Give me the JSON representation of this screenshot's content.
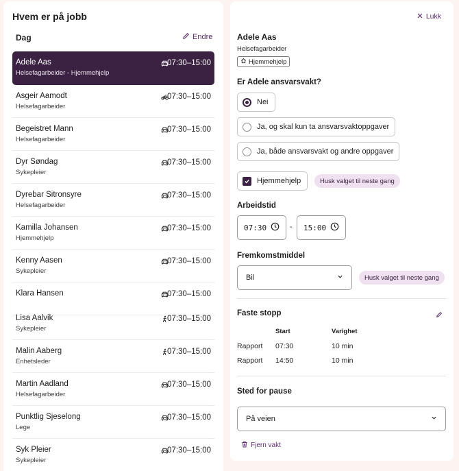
{
  "left": {
    "title": "Hvem er på jobb",
    "section": "Dag",
    "edit_label": "Endre",
    "employees": [
      {
        "name": "Adele Aas",
        "role": "Helsefagarbeider - Hjemmehjelp",
        "time": "07:30–15:00",
        "transport": "car-icon",
        "selected": true
      },
      {
        "name": "Asgeir Aamodt",
        "role": "Helsefagarbeider",
        "time": "07:30–15:00",
        "transport": "bicycle-icon"
      },
      {
        "name": "Begeistret Mann",
        "role": "Helsefagarbeider",
        "time": "07:30–15:00",
        "transport": "car-icon"
      },
      {
        "name": "Dyr Søndag",
        "role": "Sykepleier",
        "time": "07:30–15:00",
        "transport": "car-icon"
      },
      {
        "name": "Dyrebar Sitronsyre",
        "role": "Helsefagarbeider",
        "time": "07:30–15:00",
        "transport": "car-icon"
      },
      {
        "name": "Kamilla Johansen",
        "role": "Hjemmehjelp",
        "time": "07:30–15:00",
        "transport": "car-icon"
      },
      {
        "name": "Kenny Aasen",
        "role": "Sykepleier",
        "time": "07:30–15:00",
        "transport": "car-icon"
      },
      {
        "name": "Klara Hansen",
        "role": "",
        "time": "07:30–15:00",
        "transport": "car-icon"
      },
      {
        "name": "Lisa Aalvik",
        "role": "Sykepleier",
        "time": "07:30–15:00",
        "transport": "walking-icon"
      },
      {
        "name": "Malin Aaberg",
        "role": "Enhetsleder",
        "time": "07:30–15:00",
        "transport": "walking-icon"
      },
      {
        "name": "Martin Aadland",
        "role": "Helsefagarbeider",
        "time": "07:30–15:00",
        "transport": "car-icon"
      },
      {
        "name": "Punktlig Sjeselong",
        "role": "Lege",
        "time": "07:30–15:00",
        "transport": "car-icon"
      },
      {
        "name": "Syk Pleier",
        "role": "Sykepleier",
        "time": "07:30–15:00",
        "transport": "car-icon"
      }
    ]
  },
  "right": {
    "close_label": "Lukk",
    "name": "Adele Aas",
    "role": "Helsefagarbeider",
    "tag": "Hjemmehjelp",
    "on_call_question": "Er Adele ansvarsvakt?",
    "on_call_options": [
      {
        "label": "Nei",
        "selected": true
      },
      {
        "label": "Ja, og skal kun ta ansvarsvaktoppgaver",
        "selected": false
      },
      {
        "label": "Ja, både ansvarsvakt og andre oppgaver",
        "selected": false
      }
    ],
    "home_help": {
      "label": "Hjemmehjelp",
      "checked": true
    },
    "remember_label": "Husk valget til neste gang",
    "work_time": {
      "heading": "Arbeidstid",
      "start": "07:30",
      "separator": "-",
      "end": "15:00"
    },
    "transport": {
      "heading": "Fremkomstmiddel",
      "value": "Bil",
      "remember_label": "Husk valget til neste gang"
    },
    "fixed_stops": {
      "heading": "Faste stopp",
      "columns": [
        "",
        "Start",
        "Varighet"
      ],
      "rows": [
        {
          "name": "Rapport",
          "start": "07:30",
          "duration": "10 min"
        },
        {
          "name": "Rapport",
          "start": "14:50",
          "duration": "10 min"
        }
      ]
    },
    "break_place": {
      "heading": "Sted for pause",
      "value": "På veien"
    },
    "remove_label": "Fjern vakt"
  },
  "colors": {
    "accent": "#3b2142",
    "link": "#5b2b6e",
    "chip": "#efe1ef",
    "background": "#fdf4f1"
  }
}
